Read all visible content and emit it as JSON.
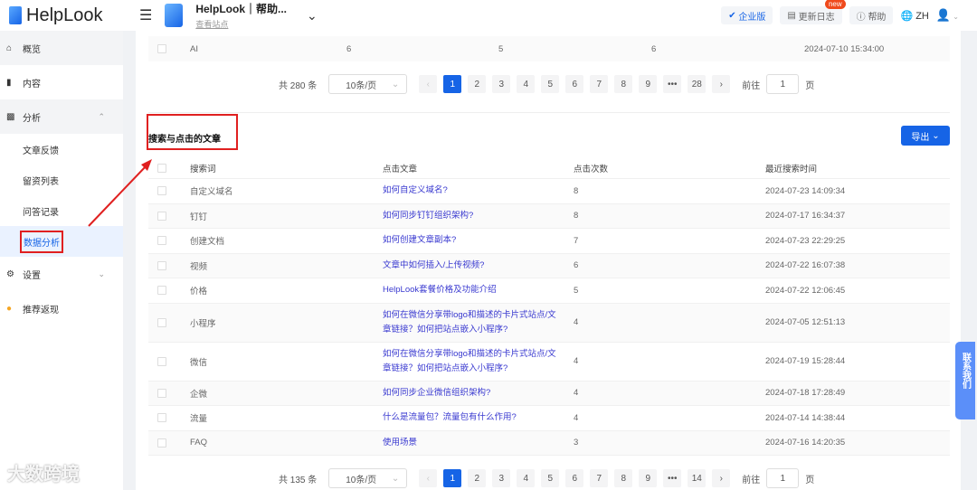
{
  "header": {
    "logo": "HelpLook",
    "site_name": "HelpLook｜帮助...",
    "site_link": "查看站点",
    "enterprise": "企业版",
    "changelog": "更新日志",
    "new_badge": "new",
    "help": "帮助",
    "lang": "ZH"
  },
  "sidebar": {
    "items": [
      {
        "label": "概览"
      },
      {
        "label": "内容"
      },
      {
        "label": "分析"
      },
      {
        "label": "设置"
      },
      {
        "label": "推荐返现"
      }
    ],
    "sub": [
      "文章反馈",
      "留资列表",
      "问答记录",
      "数据分析"
    ]
  },
  "top_table": {
    "row": [
      "AI",
      "6",
      "5",
      "6",
      "2024-07-10 15:34:00"
    ],
    "total": "共 280 条",
    "page_size": "10条/页",
    "pages": [
      "1",
      "2",
      "3",
      "4",
      "5",
      "6",
      "7",
      "8",
      "9",
      "•••",
      "28"
    ],
    "goto": "前往",
    "goto_value": "1",
    "page_unit": "页"
  },
  "section": {
    "title": "搜索与点击的文章",
    "export": "导出"
  },
  "table": {
    "headers": [
      "搜索词",
      "点击文章",
      "点击次数",
      "最近搜索时间"
    ],
    "rows": [
      [
        "自定义域名",
        "如何自定义域名?",
        "8",
        "2024-07-23 14:09:34"
      ],
      [
        "钉钉",
        "如何同步钉钉组织架构?",
        "8",
        "2024-07-17 16:34:37"
      ],
      [
        "创建文档",
        "如何创建文章副本?",
        "7",
        "2024-07-23 22:29:25"
      ],
      [
        "视频",
        "文章中如何插入/上传视频?",
        "6",
        "2024-07-22 16:07:38"
      ],
      [
        "价格",
        "HelpLook套餐价格及功能介绍",
        "5",
        "2024-07-22 12:06:45"
      ],
      [
        "小程序",
        "如何在微信分享带logo和描述的卡片式站点/文章链接？如何把站点嵌入小程序?",
        "4",
        "2024-07-05 12:51:13"
      ],
      [
        "微信",
        "如何在微信分享带logo和描述的卡片式站点/文章链接？如何把站点嵌入小程序?",
        "4",
        "2024-07-19 15:28:44"
      ],
      [
        "企微",
        "如何同步企业微信组织架构?",
        "4",
        "2024-07-18 17:28:49"
      ],
      [
        "流量",
        "什么是流量包？流量包有什么作用?",
        "4",
        "2024-07-14 14:38:44"
      ],
      [
        "FAQ",
        "使用场景",
        "3",
        "2024-07-16 14:20:35"
      ]
    ],
    "total": "共 135 条",
    "page_size": "10条/页",
    "pages": [
      "1",
      "2",
      "3",
      "4",
      "5",
      "6",
      "7",
      "8",
      "9",
      "•••",
      "14"
    ],
    "goto": "前往",
    "goto_value": "1",
    "page_unit": "页"
  },
  "float_button": "联系我们",
  "watermark": "大数跨境"
}
